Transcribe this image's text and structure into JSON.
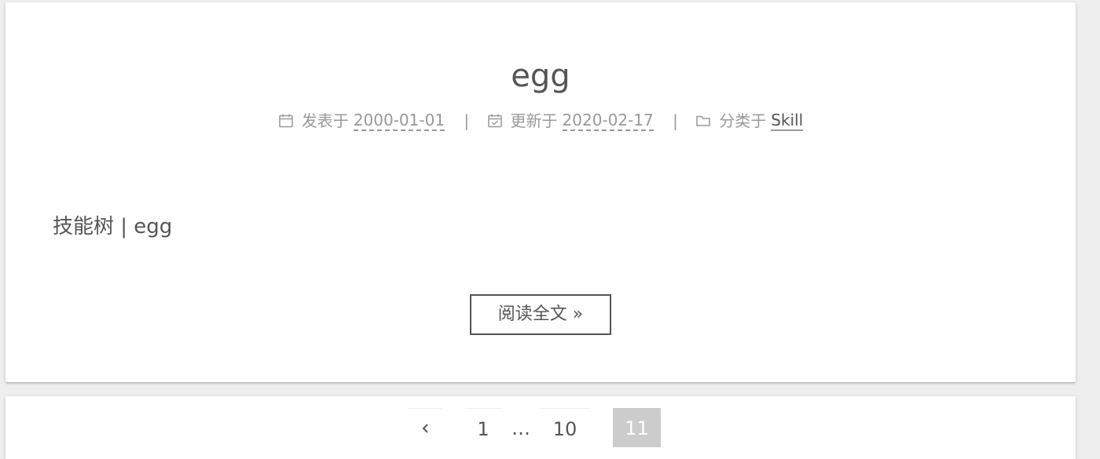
{
  "post": {
    "title": "egg",
    "meta": {
      "posted_label": "发表于",
      "posted_date": "2000-01-01",
      "divider": "|",
      "updated_label": "更新于",
      "updated_date": "2020-02-17",
      "category_label": "分类于",
      "category": "Skill"
    },
    "excerpt": "技能树 | egg",
    "read_more_label": "阅读全文 »"
  },
  "pagination": {
    "pages": [
      "1",
      "…",
      "10",
      "11"
    ],
    "current": "11"
  },
  "icons": {
    "posted": "calendar-icon",
    "updated": "calendar-check-icon",
    "category": "folder-icon",
    "prev": "chevron-left-icon"
  },
  "colors": {
    "background": "#eeeeee",
    "card": "#ffffff",
    "text": "#555555",
    "meta": "#999999",
    "current_page_bg": "#cccccc"
  }
}
